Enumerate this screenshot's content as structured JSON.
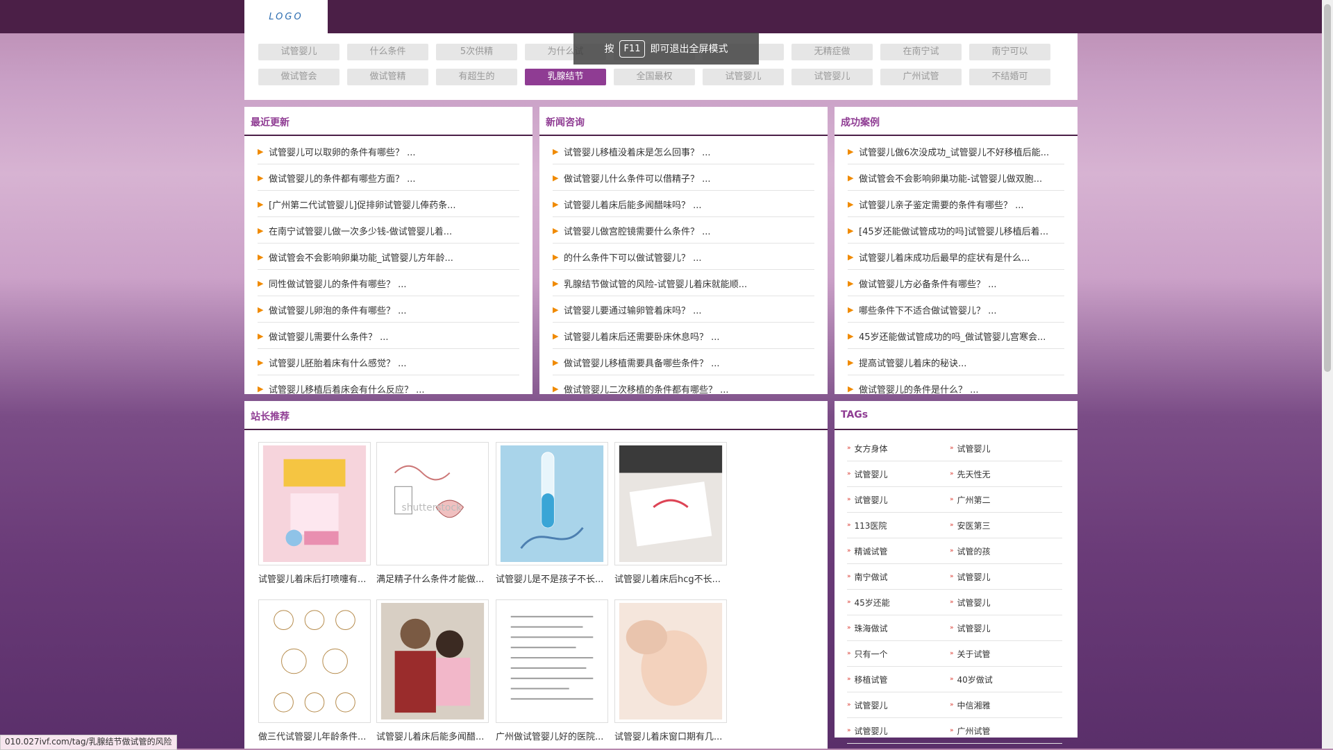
{
  "logo": {
    "text": "LOGO"
  },
  "fullscreen_hint": {
    "before": "按",
    "key": "F11",
    "after": "即可退出全屏模式"
  },
  "tag_buttons": [
    [
      "试管婴儿",
      "什么条件",
      "5次供精",
      "为什么试",
      "",
      "",
      "无精症做",
      "在南宁试",
      "南宁可以"
    ],
    [
      "做试管会",
      "做试管精",
      "有超生的",
      "乳腺结节",
      "全国最权",
      "试管婴儿",
      "试管婴儿",
      "广州试管",
      "不结婚可"
    ]
  ],
  "active_tag": "乳腺结节",
  "panels": {
    "recent": {
      "title": "最近更新",
      "items": [
        "试管婴儿可以取卵的条件有哪些？ ...",
        "做试管婴儿的条件都有哪些方面？ ...",
        "[广州第二代试管婴儿]促排卵试管婴儿俸药条...",
        "在南宁试管婴儿做一次多少钱-做试管婴儿着...",
        "做试管会不会影响卵巢功能_试管婴儿方年龄...",
        "同性做试管婴儿的条件有哪些？ ...",
        "做试管婴儿卵泡的条件有哪些？ ...",
        "做试管婴儿需要什么条件？ ...",
        "试管婴儿胚胎着床有什么感觉？ ...",
        "试管婴儿移植后着床会有什么反应？ ..."
      ]
    },
    "news": {
      "title": "新闻咨询",
      "items": [
        "试管婴儿移植没着床是怎么回事？ ...",
        "做试管婴儿什么条件可以借精子？ ...",
        "试管婴儿着床后能多闻醋味吗？ ...",
        "试管婴儿做宫腔镜需要什么条件？ ...",
        "的什么条件下可以做试管婴儿？ ...",
        "乳腺结节做试管的风险-试管婴儿着床就能顺...",
        "试管婴儿要通过输卵管着床吗？ ...",
        "试管婴儿着床后还需要卧床休息吗？ ...",
        "做试管婴儿移植需要具备哪些条件？ ...",
        "做试管婴儿二次移植的条件都有哪些？ ..."
      ]
    },
    "success": {
      "title": "成功案例",
      "items": [
        "试管婴儿做6次没成功_试管婴儿不好移植后能...",
        "做试管会不会影响卵巢功能-试管婴儿做双胞...",
        "试管婴儿亲子鉴定需要的条件有哪些？ ...",
        "[45岁还能做试管成功的吗]试管婴儿移植后着...",
        "试管婴儿着床成功后最早的症状有是什么...",
        "做试管婴儿方必备条件有哪些？ ...",
        "哪些条件下不适合做试管婴儿？ ...",
        "45岁还能做试管成功的吗_做试管婴儿宫寒会...",
        "提高试管婴儿着床的秘诀...",
        "做试管婴儿的条件是什么？ ..."
      ]
    }
  },
  "recommend": {
    "title": "站长推荐",
    "cards": [
      {
        "caption": "试管婴儿着床后打喷嚏有...",
        "image": "pink-poster"
      },
      {
        "caption": "满足精子什么条件才能做...",
        "image": "anatomy-sketch"
      },
      {
        "caption": "试管婴儿是不是孩子不长...",
        "image": "dna-test-tube"
      },
      {
        "caption": "试管婴儿着床后hcg不长...",
        "image": "doctor-diagram"
      },
      {
        "caption": "做三代试管婴儿年龄条件...",
        "image": "ivf-steps"
      },
      {
        "caption": "试管婴儿着床后能多闻醋...",
        "image": "father-daughter"
      },
      {
        "caption": "广州做试管婴儿好的医院...",
        "image": "document"
      },
      {
        "caption": "试管婴儿着床窗口期有几...",
        "image": "baby"
      }
    ]
  },
  "tags_panel": {
    "title": "TAGs",
    "rows": [
      [
        "女方身体",
        "试管婴儿"
      ],
      [
        "试管婴儿",
        "先天性无"
      ],
      [
        "试管婴儿",
        "广州第二"
      ],
      [
        "113医院",
        "安医第三"
      ],
      [
        "精诚试管",
        "试管的孩"
      ],
      [
        "南宁做试",
        "试管婴儿"
      ],
      [
        "45岁还能",
        "试管婴儿"
      ],
      [
        "珠海做试",
        "试管婴儿"
      ],
      [
        "只有一个",
        "关于试管"
      ],
      [
        "移植试管",
        "40岁做试"
      ],
      [
        "试管婴儿",
        "中信湘雅"
      ],
      [
        "试管婴儿",
        "广州试管"
      ]
    ]
  },
  "status_url": "010.027ivf.com/tag/乳腺结节做试管的风险",
  "colors": {
    "accent": "#8f3c93",
    "header": "#4b1f47",
    "arrow": "#f08a00"
  }
}
